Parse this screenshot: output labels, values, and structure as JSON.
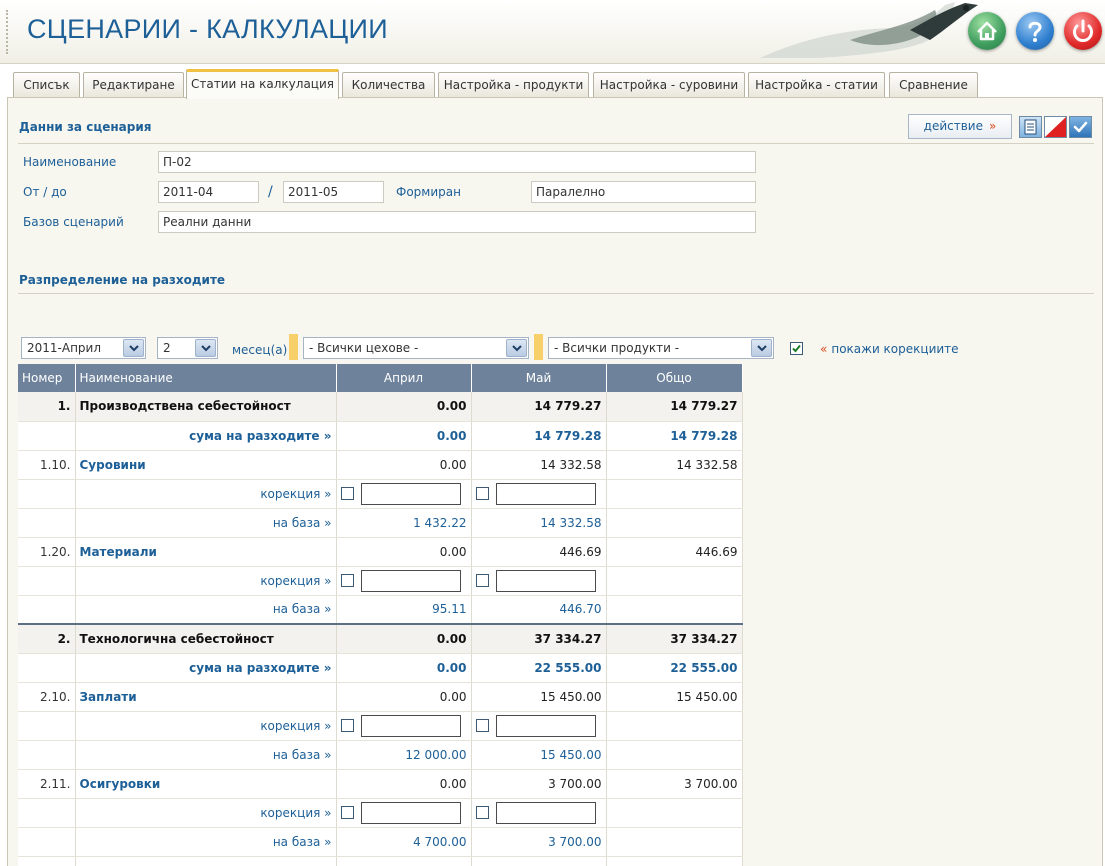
{
  "header": {
    "title": "СЦЕНАРИИ - КАЛКУЛАЦИИ",
    "buttons": [
      "home",
      "help",
      "power"
    ]
  },
  "tabs": [
    {
      "label": "Списък",
      "active": false
    },
    {
      "label": "Редактиране",
      "active": false
    },
    {
      "label": "Статии на калкулация",
      "active": true
    },
    {
      "label": "Количества",
      "active": false
    },
    {
      "label": "Настройка - продукти",
      "active": false
    },
    {
      "label": "Настройка - суровини",
      "active": false
    },
    {
      "label": "Настройка - статии",
      "active": false
    },
    {
      "label": "Сравнение",
      "active": false
    }
  ],
  "scenario": {
    "section_title": "Данни за сценария",
    "action_label": "действие",
    "action_arrow": "»",
    "name_label": "Наименование",
    "name_value": "П-02",
    "period_label": "От / до",
    "from_value": "2011-04",
    "separator": "/",
    "to_value": "2011-05",
    "formed_label": "Формиран",
    "formed_value": "Паралелно",
    "base_label": "Базов сценарий",
    "base_value": "Реални данни"
  },
  "distribution": {
    "section_title": "Разпределение на разходите",
    "month_select": "2011-Април",
    "count_select": "2",
    "months_label": "месец(а)",
    "workshops_select": "- Всички цехове -",
    "products_select": "- Всички продукти -",
    "show_corrections_checked": true,
    "show_corrections_quote": "«",
    "show_corrections_label": "покажи корекциите"
  },
  "table": {
    "headers": {
      "number": "Номер",
      "name": "Наименование",
      "april": "Април",
      "may": "Май",
      "total": "Общо"
    },
    "rows": [
      {
        "type": "group",
        "num": "1.",
        "name": "Производствена себестойност",
        "april": "0.00",
        "may": "14 779.27",
        "total": "14 779.27"
      },
      {
        "type": "sum",
        "name": "сума на разходите »",
        "april": "0.00",
        "may": "14 779.28",
        "total": "14 779.28"
      },
      {
        "type": "item",
        "num": "1.10.",
        "name": "Суровини",
        "april": "0.00",
        "may": "14 332.58",
        "total": "14 332.58"
      },
      {
        "type": "correction",
        "name": "корекция »"
      },
      {
        "type": "base",
        "name": "на база »",
        "april": "1 432.22",
        "may": "14 332.58"
      },
      {
        "type": "item",
        "num": "1.20.",
        "name": "Материали",
        "april": "0.00",
        "may": "446.69",
        "total": "446.69"
      },
      {
        "type": "correction",
        "name": "корекция »"
      },
      {
        "type": "base",
        "name": "на база »",
        "april": "95.11",
        "may": "446.70"
      },
      {
        "type": "group",
        "sep": true,
        "num": "2.",
        "name": "Технологична себестойност",
        "april": "0.00",
        "may": "37 334.27",
        "total": "37 334.27"
      },
      {
        "type": "sum",
        "name": "сума на разходите »",
        "april": "0.00",
        "may": "22 555.00",
        "total": "22 555.00"
      },
      {
        "type": "item",
        "num": "2.10.",
        "name": "Заплати",
        "april": "0.00",
        "may": "15 450.00",
        "total": "15 450.00"
      },
      {
        "type": "correction",
        "name": "корекция »"
      },
      {
        "type": "base",
        "name": "на база »",
        "april": "12 000.00",
        "may": "15 450.00"
      },
      {
        "type": "item",
        "num": "2.11.",
        "name": "Осигуровки",
        "april": "0.00",
        "may": "3 700.00",
        "total": "3 700.00"
      },
      {
        "type": "correction",
        "name": "корекция »"
      },
      {
        "type": "base",
        "name": "на база »",
        "april": "4 700.00",
        "may": "3 700.00"
      },
      {
        "type": "blank"
      }
    ]
  },
  "colors": {
    "accent": "#1d5f97",
    "header_row": "#6e839b",
    "arrow": "#d84a1b",
    "tab_highlight": "#f0c040"
  }
}
